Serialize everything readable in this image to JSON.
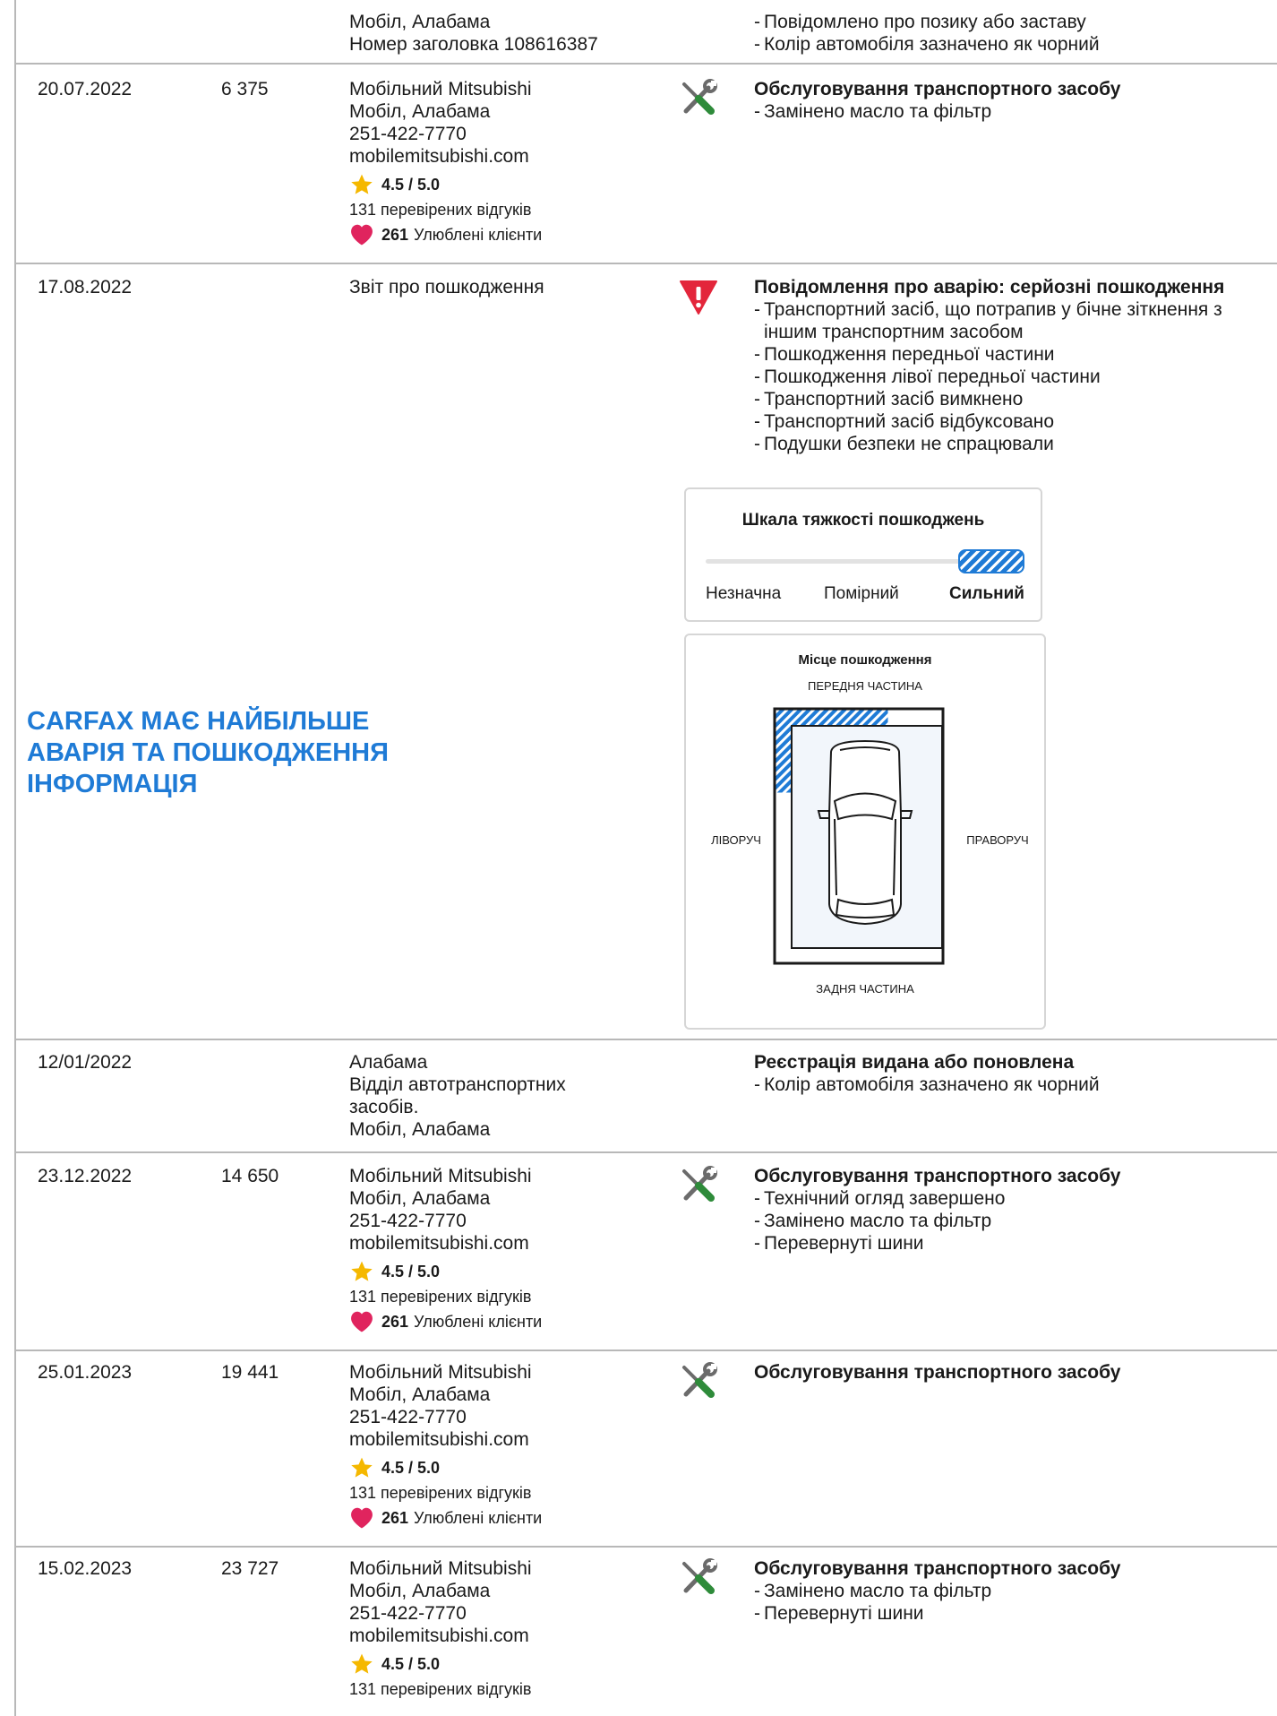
{
  "rows": [
    {
      "date": "",
      "odometer": "",
      "source": [
        "Мобіл, Алабама",
        "Номер заголовка 108616387"
      ],
      "comment_title": "",
      "comment_items": [
        "Повідомлено про позику або заставу",
        "Колір автомобіля зазначено як чорний"
      ]
    },
    {
      "date": "20.07.2022",
      "odometer": "6 375",
      "source": [
        "Мобільний Mitsubishi",
        "Мобіл, Алабама",
        "251-422-7770",
        "mobilemitsubishi.com"
      ],
      "rating": "4.5 / 5.0",
      "reviews": "131 перевірених відгуків",
      "favorites_count": "261",
      "favorites_label": "Улюблені клієнти",
      "icon": "wrench-screwdriver-icon",
      "comment_title": "Обслуговування транспортного засобу",
      "comment_items": [
        "Замінено масло та фільтр"
      ]
    },
    {
      "date": "17.08.2022",
      "odometer": "",
      "source": [
        "Звіт про пошкодження"
      ],
      "icon": "warning-icon",
      "comment_title": "Повідомлення про аварію: серйозні пошкодження",
      "comment_items": [
        "Транспортний засіб, що потрапив у бічне зіткнення з іншим транспортним засобом",
        "Пошкодження передньої частини",
        "Пошкодження лівої передньої частини",
        "Транспортний засіб вимкнено",
        "Транспортний засіб відбуксовано",
        "Подушки безпеки не спрацювали"
      ]
    },
    {
      "date": "12/01/2022",
      "odometer": "",
      "source": [
        "Алабама",
        "Відділ автотранспортних засобів.",
        "Мобіл, Алабама"
      ],
      "comment_title": "Реєстрація видана або поновлена",
      "comment_items": [
        "Колір автомобіля зазначено як чорний"
      ]
    },
    {
      "date": "23.12.2022",
      "odometer": "14 650",
      "source": [
        "Мобільний Mitsubishi",
        "Мобіл, Алабама",
        "251-422-7770",
        "mobilemitsubishi.com"
      ],
      "rating": "4.5 / 5.0",
      "reviews": "131 перевірених відгуків",
      "favorites_count": "261",
      "favorites_label": "Улюблені клієнти",
      "icon": "wrench-screwdriver-icon",
      "comment_title": "Обслуговування транспортного засобу",
      "comment_items": [
        "Технічний огляд завершено",
        "Замінено масло та фільтр",
        "Перевернуті шини"
      ]
    },
    {
      "date": "25.01.2023",
      "odometer": "19 441",
      "source": [
        "Мобільний Mitsubishi",
        "Мобіл, Алабама",
        "251-422-7770",
        "mobilemitsubishi.com"
      ],
      "rating": "4.5 / 5.0",
      "reviews": "131 перевірених відгуків",
      "favorites_count": "261",
      "favorites_label": "Улюблені клієнти",
      "icon": "wrench-screwdriver-icon",
      "comment_title": "Обслуговування транспортного засобу",
      "comment_items": []
    },
    {
      "date": "15.02.2023",
      "odometer": "23 727",
      "source": [
        "Мобільний Mitsubishi",
        "Мобіл, Алабама",
        "251-422-7770",
        "mobilemitsubishi.com"
      ],
      "rating": "4.5 / 5.0",
      "reviews": "131 перевірених відгуків",
      "icon": "wrench-screwdriver-icon",
      "comment_title": "Обслуговування транспортного засобу",
      "comment_items": [
        "Замінено масло та фільтр",
        "Перевернуті шини"
      ]
    }
  ],
  "promo": [
    "CARFAX МАЄ НАЙБІЛЬШЕ",
    "АВАРІЯ ТА ПОШКОДЖЕННЯ",
    "ІНФОРМАЦІЯ"
  ],
  "severity": {
    "title": "Шкала тяжкості пошкоджень",
    "labels": [
      "Незначна",
      "Помірний",
      "Сильний"
    ],
    "selected": "Сильний"
  },
  "damage_location": {
    "title": "Місце пошкодження",
    "front": "ПЕРЕДНЯ ЧАСТИНА",
    "rear": "ЗАДНЯ ЧАСТИНА",
    "left": "ЛІВОРУЧ",
    "right": "ПРАВОРУЧ",
    "damaged_areas": [
      "front",
      "left-front"
    ]
  },
  "colors": {
    "accent": "#1f7bd6",
    "warning": "#e3263b",
    "heart": "#e0245e",
    "star": "#f5b800",
    "tool_green": "#2e8b3a",
    "tool_gray": "#6b6b6b"
  }
}
